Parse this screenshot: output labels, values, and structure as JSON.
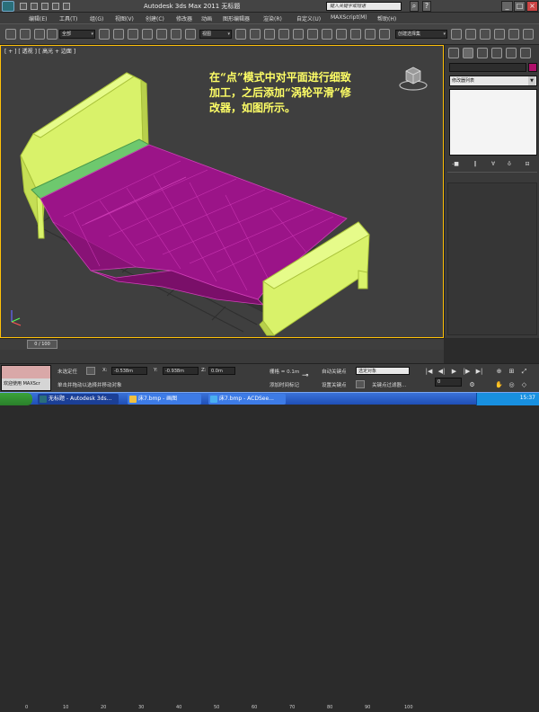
{
  "window": {
    "title": "Autodesk 3ds Max  2011     无标题",
    "search_placeholder": "键入关键字或短语"
  },
  "menu": [
    "编辑(E)",
    "工具(T)",
    "组(G)",
    "视图(V)",
    "创建(C)",
    "修改器",
    "动画",
    "图形编辑器",
    "渲染(R)",
    "自定义(U)",
    "MAXScript(M)",
    "帮助(H)"
  ],
  "toolbar": {
    "filter": "全部",
    "ref_coord": "视图",
    "selection_set": "创建选择集"
  },
  "viewport": {
    "label": "[ + ] [ 透视 ] [ 高光 + 边面 ]",
    "annotation": "在“点”模式中对平面进行细致加工，之后添加“涡轮平滑”修改器，如图所示。"
  },
  "command_panel": {
    "modifier_list": "修改器列表"
  },
  "timeline": {
    "slider": "0 / 100",
    "ticks": [
      "0",
      "10",
      "20",
      "30",
      "40",
      "50",
      "60",
      "70",
      "80",
      "90",
      "100"
    ]
  },
  "status": {
    "welcome": "欢迎使用 MAXScr",
    "none_selected": "未选定任",
    "prompt": "单击并拖动以选择并移动对象",
    "x_label": "X:",
    "x_value": "-0.538m",
    "y_label": "Y:",
    "y_value": "-0.938m",
    "z_label": "Z:",
    "z_value": "0.0m",
    "grid": "栅格 = 0.1m",
    "add_time_tag": "添加时间标记",
    "auto_key": "自动关键点",
    "selected_object": "选定对象",
    "set_key": "设置关键点",
    "key_filters": "关键点过滤器...",
    "frame": "0"
  },
  "taskbar": {
    "tasks": [
      "无标题 - Autodesk 3ds...",
      "床7.bmp - 画图",
      "床7.bmp - ACDSee..."
    ],
    "clock": "15:37"
  },
  "colors": {
    "bed_frame": "#d9f26a",
    "blanket": "#9b1488",
    "mattress": "#6ec86e",
    "annotation": "#ffff66"
  }
}
